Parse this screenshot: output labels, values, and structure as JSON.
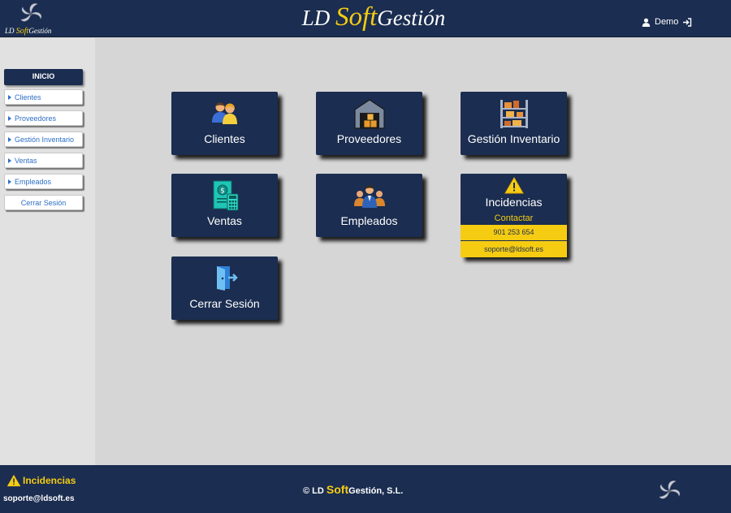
{
  "header": {
    "logo": {
      "ld": "LD",
      "soft": "Soft",
      "gestion": "Gestión"
    },
    "brand": {
      "ld": "LD",
      "soft": "Soft",
      "gestion": "Gestión"
    },
    "user_name": "Demo",
    "icons": [
      "user-icon",
      "logout-icon"
    ]
  },
  "sidebar": {
    "header": "INICIO",
    "items": [
      {
        "label": "Clientes"
      },
      {
        "label": "Proveedores"
      },
      {
        "label": "Gestión Inventario"
      },
      {
        "label": "Ventas"
      },
      {
        "label": "Empleados"
      },
      {
        "label": "Cerrar Sesión"
      }
    ]
  },
  "tiles": [
    {
      "label": "Clientes",
      "icon": "customers-icon"
    },
    {
      "label": "Proveedores",
      "icon": "warehouse-icon"
    },
    {
      "label": "Gestión Inventario",
      "icon": "shelving-icon"
    },
    {
      "label": "Ventas",
      "icon": "invoice-calculator-icon"
    },
    {
      "label": "Empleados",
      "icon": "employees-icon"
    },
    {
      "label": "Cerrar Sesión",
      "icon": "exit-door-icon"
    }
  ],
  "incidencias": {
    "title": "Incidencias",
    "contact": "Contactar",
    "phone": "901 253 654",
    "email": "soporte@ldsoft.es",
    "icon": "warning-icon"
  },
  "footer": {
    "incidencias": "Incidencias",
    "email": "soporte@ldsoft.es",
    "copy_prefix": "© LD",
    "copy_soft": "Soft",
    "copy_suffix": "Gestión, S.L."
  },
  "colors": {
    "navy": "#1b2d50",
    "accent": "#f5cc12",
    "link": "#2d6fc4",
    "background": "#d6d6d6"
  }
}
